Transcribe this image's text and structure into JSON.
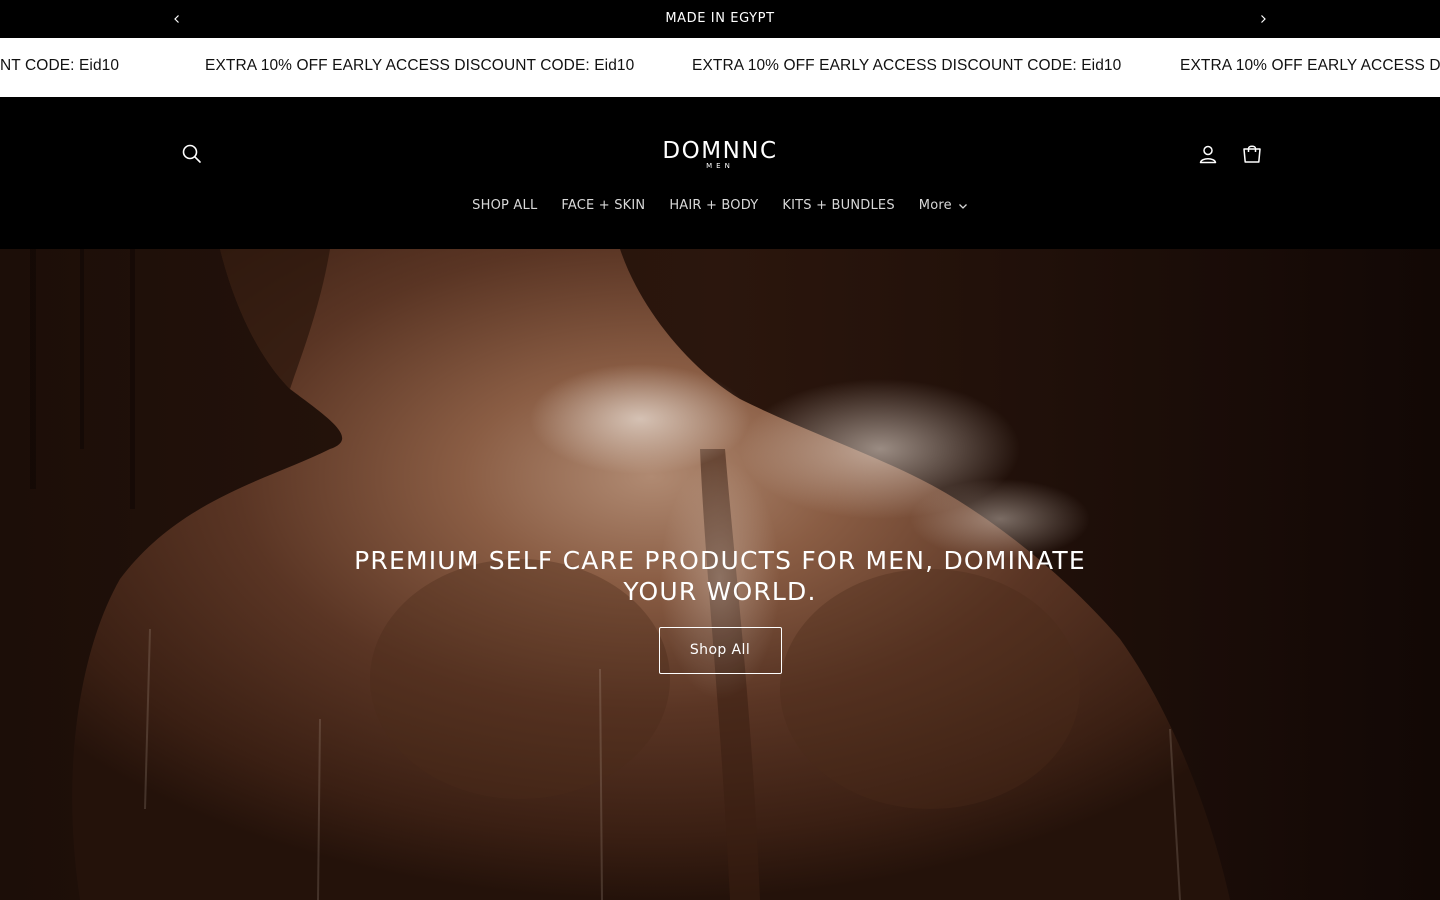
{
  "announcement": {
    "text": "MADE IN EGYPT",
    "prev_icon": "chevron-left-icon",
    "next_icon": "chevron-right-icon"
  },
  "marquee": {
    "items": [
      "NT CODE: Eid10",
      "EXTRA 10% OFF EARLY ACCESS DISCOUNT CODE: Eid10",
      "EXTRA 10% OFF EARLY ACCESS DISCOUNT CODE: Eid10",
      "EXTRA 10% OFF EARLY ACCESS DISCO"
    ]
  },
  "header": {
    "logo_main": "DOMNNC",
    "logo_sub": "MEN",
    "search_icon": "search-icon",
    "account_icon": "user-icon",
    "cart_icon": "cart-icon"
  },
  "nav": {
    "items": [
      {
        "label": "SHOP ALL"
      },
      {
        "label": "FACE + SKIN"
      },
      {
        "label": "HAIR + BODY"
      },
      {
        "label": "KITS + BUNDLES"
      },
      {
        "label": "More",
        "icon": "chevron-down-icon"
      }
    ]
  },
  "hero": {
    "title": "PREMIUM SELF CARE PRODUCTS FOR MEN, DOMINATE YOUR WORLD.",
    "button_label": "Shop All"
  },
  "colors": {
    "background": "#000000",
    "marquee_bg": "#ffffff",
    "text": "#ffffff",
    "hero_tone": "#6a4330"
  }
}
